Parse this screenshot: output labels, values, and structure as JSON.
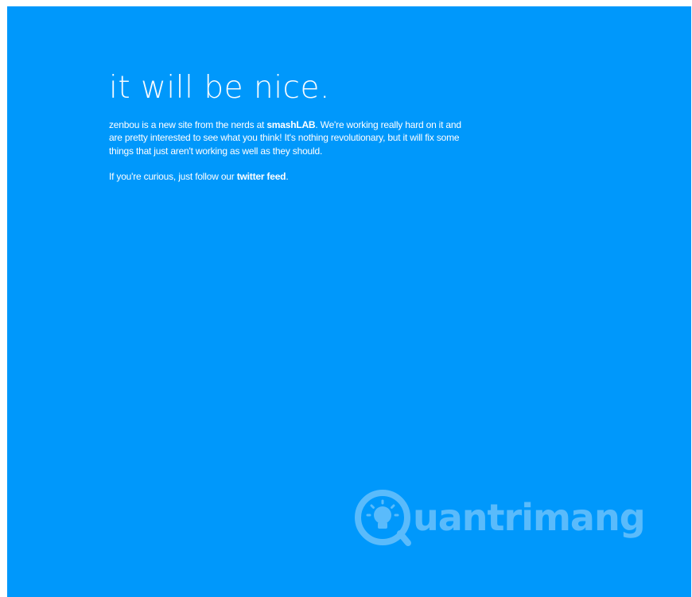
{
  "page": {
    "background_color": "#0098fb",
    "text_color": "#ffffff"
  },
  "main": {
    "headline": "it will be nice.",
    "intro": {
      "text_before_link": "zenbou is a new site from the nerds at ",
      "link_label": "smashLAB",
      "text_after_link": ". We're working really hard on it and are pretty interested to see what you think! It's nothing revolutionary, but it will fix some things that just aren't working as well as they should."
    },
    "follow": {
      "text_before_link": "If you're curious, just follow our ",
      "link_label": "twitter feed",
      "text_after_link": "."
    }
  },
  "watermark": {
    "text": "uantrimang",
    "icon": "lightbulb-icon"
  }
}
